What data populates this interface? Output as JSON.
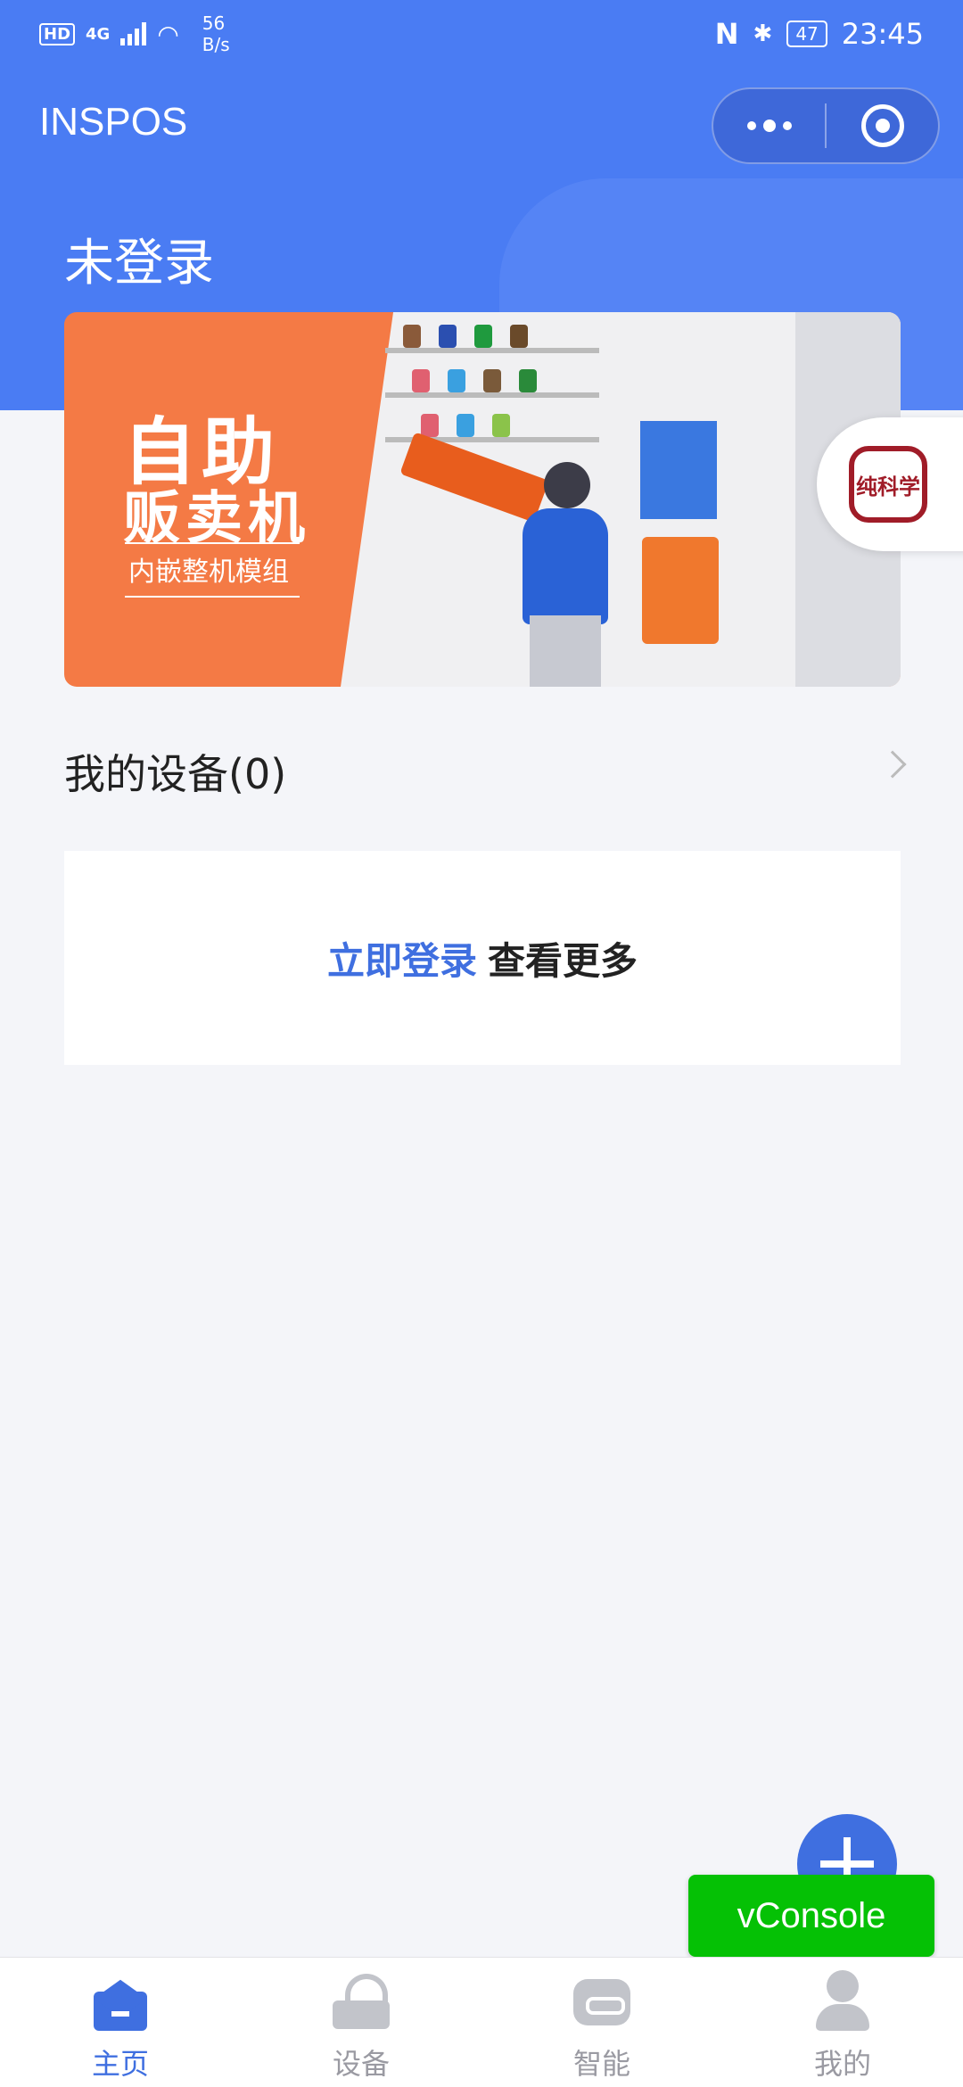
{
  "status_bar": {
    "hd": "HD",
    "network": "4G",
    "speed_value": "56",
    "speed_unit": "B/s",
    "nfc": "N",
    "bluetooth": "✱",
    "battery": "47",
    "time": "23:45"
  },
  "nav": {
    "title": "INSPOS"
  },
  "header": {
    "login_status": "未登录"
  },
  "banner": {
    "title_line1": "自助",
    "title_line2": "贩卖机",
    "subtitle": "内嵌整机模组"
  },
  "floating_badge": {
    "text": "纯科学"
  },
  "devices": {
    "title": "我的设备(0)"
  },
  "login_card": {
    "link": "立即登录",
    "text": "查看更多"
  },
  "vconsole": {
    "label": "vConsole"
  },
  "tabbar": {
    "tabs": [
      {
        "label": "主页",
        "icon": "home-icon",
        "active": true
      },
      {
        "label": "设备",
        "icon": "router-icon",
        "active": false
      },
      {
        "label": "智能",
        "icon": "smart-icon",
        "active": false
      },
      {
        "label": "我的",
        "icon": "user-icon",
        "active": false
      }
    ]
  },
  "colors": {
    "primary": "#4a7cf3",
    "link": "#3f6fe0",
    "banner_orange": "#f47a45",
    "vconsole_green": "#05c105",
    "page_bg": "#f4f5f9"
  }
}
